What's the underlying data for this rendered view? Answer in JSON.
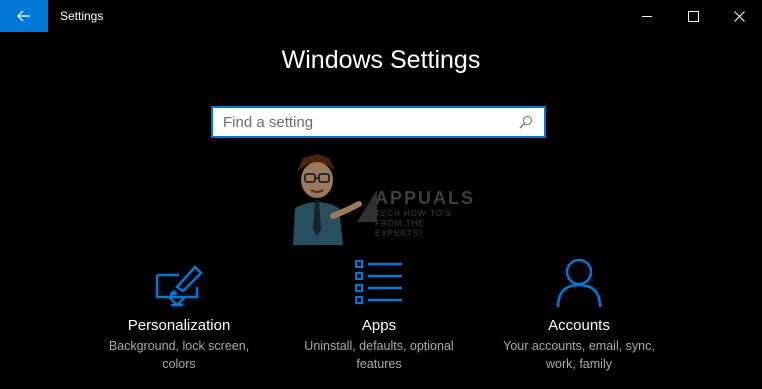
{
  "window": {
    "title": "Settings",
    "controls": [
      "minimize-icon",
      "maximize-icon",
      "close-icon"
    ]
  },
  "header": {
    "title": "Windows Settings"
  },
  "search": {
    "placeholder": "Find a setting",
    "value": ""
  },
  "watermark": {
    "brand": "APPUALS",
    "tagline": "TECH HOW-TO'S FROM THE EXPERTS!"
  },
  "tiles": [
    {
      "icon": "personalization-icon",
      "title": "Personalization",
      "desc_line1": "Background, lock screen,",
      "desc_line2": "colors"
    },
    {
      "icon": "apps-icon",
      "title": "Apps",
      "desc_line1": "Uninstall, defaults, optional",
      "desc_line2": "features"
    },
    {
      "icon": "accounts-icon",
      "title": "Accounts",
      "desc_line1": "Your accounts, email, sync,",
      "desc_line2": "work, family"
    }
  ],
  "colors": {
    "accent": "#0078d7",
    "background": "#000000",
    "text": "#ffffff",
    "secondary_text": "#aaaaaa"
  }
}
